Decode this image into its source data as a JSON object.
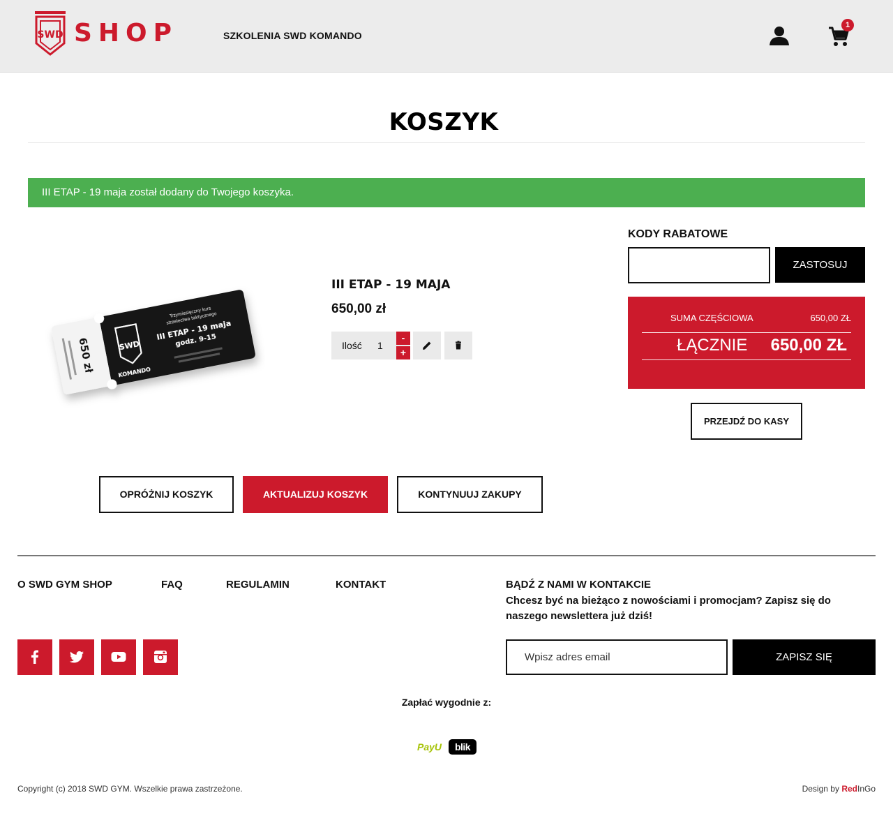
{
  "header": {
    "shop_label": "SHOP",
    "nav_link": "SZKOLENIA SWD KOMANDO",
    "cart_count": "1",
    "icons": [
      "swd-shield-logo",
      "user-icon",
      "cart-icon"
    ],
    "brand_color": "#cc1a2c"
  },
  "page": {
    "title": "KOSZYK",
    "notice": "III ETAP - 19 maja został dodany do Twojego koszyka.",
    "notice_color": "#4caf50"
  },
  "cart_item": {
    "name": "III ETAP - 19 MAJA",
    "price": "650,00 zł",
    "qty_label": "Ilość",
    "qty_value": "1",
    "qty_minus": "-",
    "qty_plus": "+",
    "ticket": {
      "brand": "KOMANDO",
      "subtitle_line1": "Trzymiesięczny kurs",
      "subtitle_line2": "strzelectwa taktycznego",
      "event_title": "III ETAP - 19 maja",
      "hours": "godz. 9-15",
      "price": "650 zł"
    }
  },
  "discount": {
    "title": "KODY RABATOWE",
    "apply_label": "ZASTOSUJ"
  },
  "totals": {
    "subtotal_label": "SUMA CZĘŚCIOWA",
    "subtotal_value": "650,00 ZŁ",
    "total_label": "ŁĄCZNIE",
    "total_value": "650,00 ZŁ",
    "checkout_label": "PRZEJDŹ DO KASY"
  },
  "cart_actions": {
    "empty_label": "OPRÓŻNIJ KOSZYK",
    "update_label": "AKTUALIZUJ KOSZYK",
    "continue_label": "KONTYNUUJ ZAKUPY"
  },
  "footer": {
    "links": [
      "O SWD GYM SHOP",
      "FAQ",
      "REGULAMIN",
      "KONTAKT"
    ],
    "contact_title": "BĄDŹ Z NAMI W KONTAKCIE",
    "contact_text": "Chcesz być na bieżąco z nowościami i promocjam? Zapisz się do naszego newslettera już dziś!",
    "email_placeholder": "Wpisz adres email",
    "subscribe_label": "ZAPISZ SIĘ",
    "social_icons": [
      "facebook-icon",
      "twitter-icon",
      "youtube-icon",
      "instagram-icon"
    ],
    "pay_title": "Zapłać wygodnie z:",
    "payu_label": "PayU",
    "blik_label": "blik",
    "copyright": "Copyright (c) 2018 SWD GYM. Wszelkie prawa zastrzeżone.",
    "design_prefix": "Design by",
    "design_red": "Red",
    "design_suffix": "InGo"
  }
}
